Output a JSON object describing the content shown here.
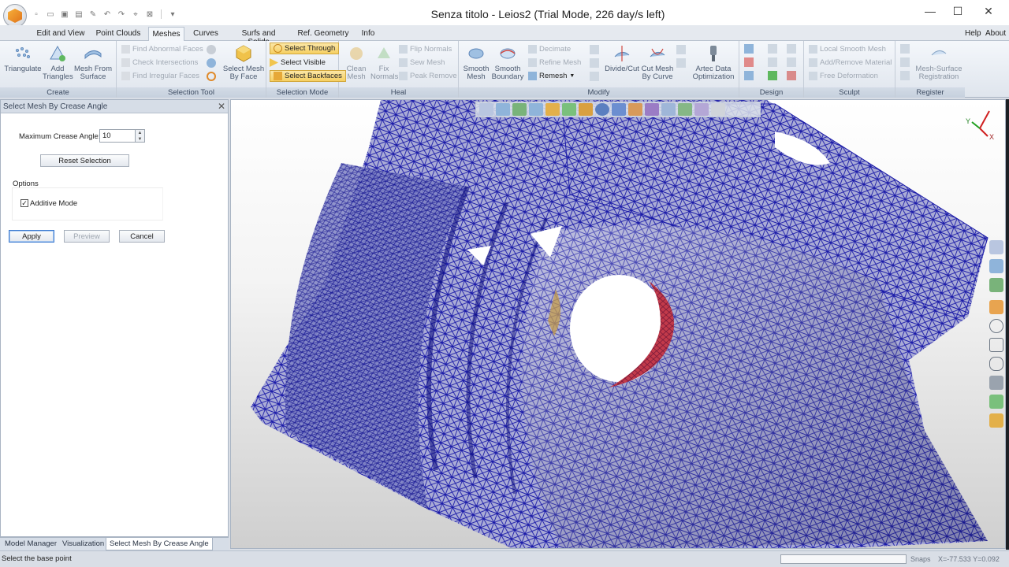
{
  "window": {
    "title": "Senza titolo - Leios2 (Trial Mode, 226 day/s left)",
    "controls": {
      "minimize": "—",
      "maximize": "☐",
      "close": "✕"
    }
  },
  "ribbon_tabs": [
    "Edit and View",
    "Point Clouds",
    "Meshes",
    "Curves",
    "Surfs and Solids",
    "Ref. Geometry",
    "Info"
  ],
  "ribbon_right": {
    "help": "Help",
    "about": "About"
  },
  "ribbon": {
    "create": {
      "label": "Create",
      "triangulate": "Triangulate",
      "add_triangles": "Add Triangles",
      "mesh_from_surface": "Mesh From Surface"
    },
    "selection_tool": {
      "label": "Selection Tool",
      "find_abnormal_faces": "Find Abnormal Faces",
      "check_intersections": "Check Intersections",
      "find_irregular_faces": "Find Irregular Faces",
      "select_mesh_by_face": "Select Mesh By Face"
    },
    "selection_mode": {
      "label": "Selection Mode",
      "select_through": "Select Through",
      "select_visible": "Select Visible",
      "select_backfaces": "Select Backfaces"
    },
    "heal": {
      "label": "Heal",
      "clean_mesh": "Clean Mesh",
      "fix_normals": "Fix Normals",
      "flip_normals": "Flip Normals",
      "sew_mesh": "Sew Mesh",
      "peak_remove": "Peak Remove"
    },
    "modify": {
      "label": "Modify",
      "smooth_mesh": "Smooth Mesh",
      "smooth_boundary": "Smooth Boundary",
      "decimate": "Decimate",
      "refine_mesh": "Refine Mesh",
      "remesh": "Remesh",
      "divide_cut": "Divide/Cut",
      "cut_mesh_by_curve": "Cut Mesh By Curve",
      "artec_data_optimization": "Artec Data Optimization"
    },
    "design": {
      "label": "Design"
    },
    "sculpt": {
      "label": "Sculpt",
      "local_smooth_mesh": "Local Smooth Mesh",
      "add_remove_material": "Add/Remove Material",
      "free_deformation": "Free Deformation"
    },
    "register": {
      "label": "Register",
      "mesh_surface_registration": "Mesh-Surface Registration"
    }
  },
  "panel": {
    "title": "Select Mesh By Crease Angle",
    "max_crease_label": "Maximum Crease Angle:",
    "max_crease_value": "10",
    "reset_selection": "Reset Selection",
    "options_label": "Options",
    "additive_mode_label": "Additive Mode",
    "additive_mode_checked": true,
    "apply": "Apply",
    "preview": "Preview",
    "cancel": "Cancel"
  },
  "bottom_tabs": [
    "Model Manager",
    "Visualization",
    "Select Mesh By Crease Angle"
  ],
  "status": {
    "message": "Select the base point",
    "snaps": "Snaps",
    "coords": "X=-77.533 Y=0.092"
  },
  "axis": {
    "y": "Y",
    "x": "X"
  },
  "colors": {
    "mesh_wire": "#1a1aa8",
    "selected": "#c23a4a",
    "accent": "#f0b433"
  }
}
